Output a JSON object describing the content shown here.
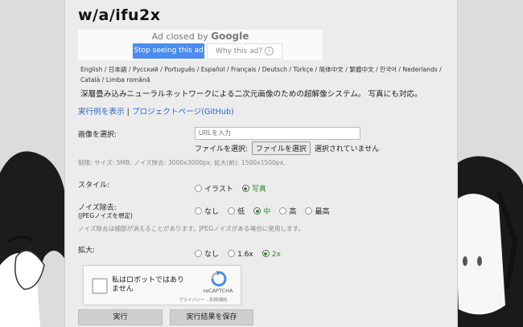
{
  "logo": {
    "text": "w/a/ifu2x"
  },
  "ad": {
    "closed_by": "Ad closed by",
    "brand": "Google",
    "stop_label": "Stop seeing this ad",
    "why_label": "Why this ad?",
    "why_icon": "info-icon"
  },
  "languages": [
    "English",
    "日本語",
    "Русский",
    "Português",
    "Español",
    "Français",
    "Deutsch",
    "Türkçe",
    "简体中文",
    "繁體中文",
    "한국어",
    "Nederlands",
    "Català",
    "Limba română"
  ],
  "description": "深層畳み込みニューラルネットワークによる二次元画像のための超解像システム。 写真にも対応。",
  "links": {
    "examples": "実行例を表示",
    "separator": "|",
    "project": "プロジェクトページ(GitHub)"
  },
  "image_select": {
    "label": "画像を選択:",
    "url_placeholder": "URLを入力",
    "file_prefix": "ファイルを選択:",
    "file_button": "ファイルを選択",
    "file_status": "選択されていません",
    "limits": "制限: サイズ: 5MB, ノイズ除去: 3000x3000px, 拡大(前): 1500x1500px."
  },
  "style": {
    "label": "スタイル:",
    "options": [
      {
        "label": "イラスト",
        "selected": false
      },
      {
        "label": "写真",
        "selected": true
      }
    ]
  },
  "noise": {
    "label": "ノイズ除去:",
    "sublabel": "(JPEGノイズを想定)",
    "options": [
      {
        "label": "なし",
        "selected": false
      },
      {
        "label": "低",
        "selected": false
      },
      {
        "label": "中",
        "selected": true
      },
      {
        "label": "高",
        "selected": false
      },
      {
        "label": "最高",
        "selected": false
      }
    ],
    "note": "ノイズ除去は細部が消えることがあります。JPEGノイズがある場合に使用します。"
  },
  "scale": {
    "label": "拡大:",
    "options": [
      {
        "label": "なし",
        "selected": false
      },
      {
        "label": "1.6x",
        "selected": false
      },
      {
        "label": "2x",
        "selected": true
      }
    ]
  },
  "captcha": {
    "text": "私はロボットではありません",
    "brand": "reCAPTCHA",
    "privacy": "プライバシー",
    "terms": "利用規約",
    "link_sep": "-"
  },
  "buttons": {
    "run": "実行",
    "save": "実行結果を保存"
  },
  "colors": {
    "accent_green": "#2e8b2e",
    "link_blue": "#2a66c9",
    "ad_button_blue": "#4a8cf0"
  }
}
